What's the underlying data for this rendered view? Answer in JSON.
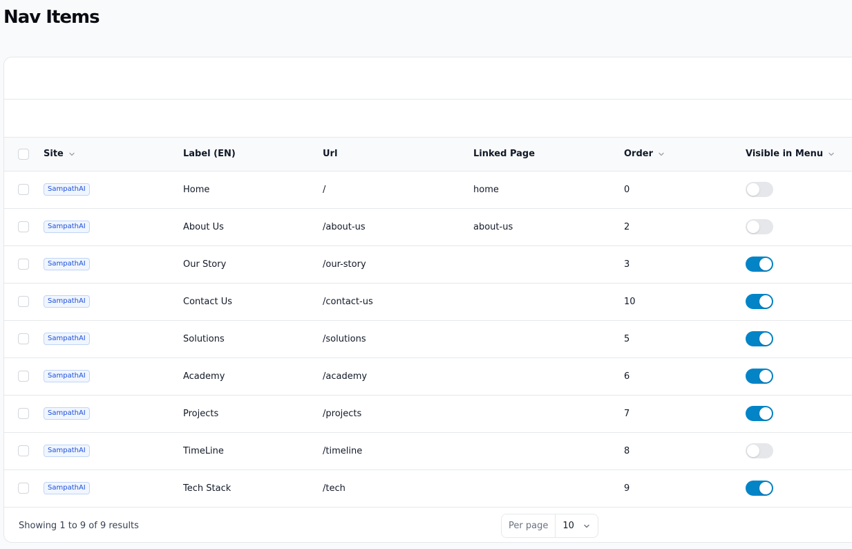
{
  "page": {
    "title": "Nav Items"
  },
  "table": {
    "headers": {
      "site": "Site",
      "label": "Label (EN)",
      "url": "Url",
      "linked_page": "Linked Page",
      "order": "Order",
      "visible": "Visible in Menu"
    },
    "rows": [
      {
        "site": "SampathAI",
        "label": "Home",
        "url": "/",
        "linked_page": "home",
        "order": "0",
        "visible": false
      },
      {
        "site": "SampathAI",
        "label": "About Us",
        "url": "/about-us",
        "linked_page": "about-us",
        "order": "2",
        "visible": false
      },
      {
        "site": "SampathAI",
        "label": "Our Story",
        "url": "/our-story",
        "linked_page": "",
        "order": "3",
        "visible": true
      },
      {
        "site": "SampathAI",
        "label": "Contact Us",
        "url": "/contact-us",
        "linked_page": "",
        "order": "10",
        "visible": true
      },
      {
        "site": "SampathAI",
        "label": "Solutions",
        "url": "/solutions",
        "linked_page": "",
        "order": "5",
        "visible": true
      },
      {
        "site": "SampathAI",
        "label": "Academy",
        "url": "/academy",
        "linked_page": "",
        "order": "6",
        "visible": true
      },
      {
        "site": "SampathAI",
        "label": "Projects",
        "url": "/projects",
        "linked_page": "",
        "order": "7",
        "visible": true
      },
      {
        "site": "SampathAI",
        "label": "TimeLine",
        "url": "/timeline",
        "linked_page": "",
        "order": "8",
        "visible": false
      },
      {
        "site": "SampathAI",
        "label": "Tech Stack",
        "url": "/tech",
        "linked_page": "",
        "order": "9",
        "visible": true
      }
    ]
  },
  "footer": {
    "results_text": "Showing 1 to 9 of 9 results",
    "per_page_label": "Per page",
    "per_page_value": "10"
  },
  "colors": {
    "accent": "#0284c7",
    "badge_text": "#1d4ed8",
    "toggle_off": "#e5e7eb"
  },
  "icons": {
    "sort": "chevron-down-icon",
    "select": "chevron-down-icon"
  }
}
